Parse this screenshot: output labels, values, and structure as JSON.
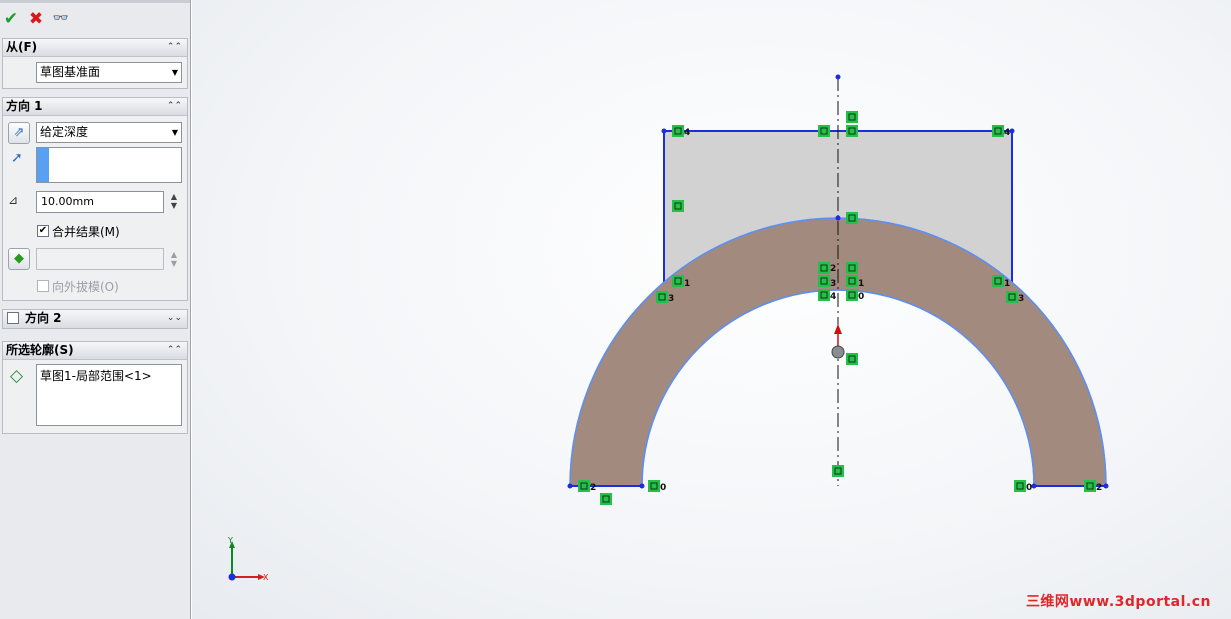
{
  "toolbar": {
    "ok_icon": "checkmark-icon",
    "cancel_icon": "x-icon",
    "preview_icon": "glasses-icon"
  },
  "from_group": {
    "title": "从(F)",
    "selected": "草图基准面"
  },
  "direction1": {
    "title": "方向 1",
    "end_condition": "给定深度",
    "depth_value": "10.00mm",
    "merge_label": "合并结果(M)",
    "merge_checked": true,
    "draft_label": "向外拔模(O)",
    "draft_checked": false
  },
  "direction2": {
    "title": "方向 2",
    "checked": false
  },
  "contours": {
    "title": "所选轮廓(S)",
    "items": [
      "草图1-局部范围<1>"
    ]
  },
  "triad": {
    "y_label": "Y",
    "x_label": "X"
  },
  "sketch_labels": [
    "4",
    "4",
    "1",
    "3",
    "1",
    "3",
    "2",
    "3",
    "4",
    "1",
    "0",
    "2",
    "0",
    "0",
    "2"
  ],
  "watermark": "三维网www.3dportal.cn",
  "colors": {
    "sketch_line": "#1b2ddc",
    "relation_green": "#24c04a",
    "region_fill": "#a38a7e",
    "rect_fill": "#d2d2d2"
  }
}
